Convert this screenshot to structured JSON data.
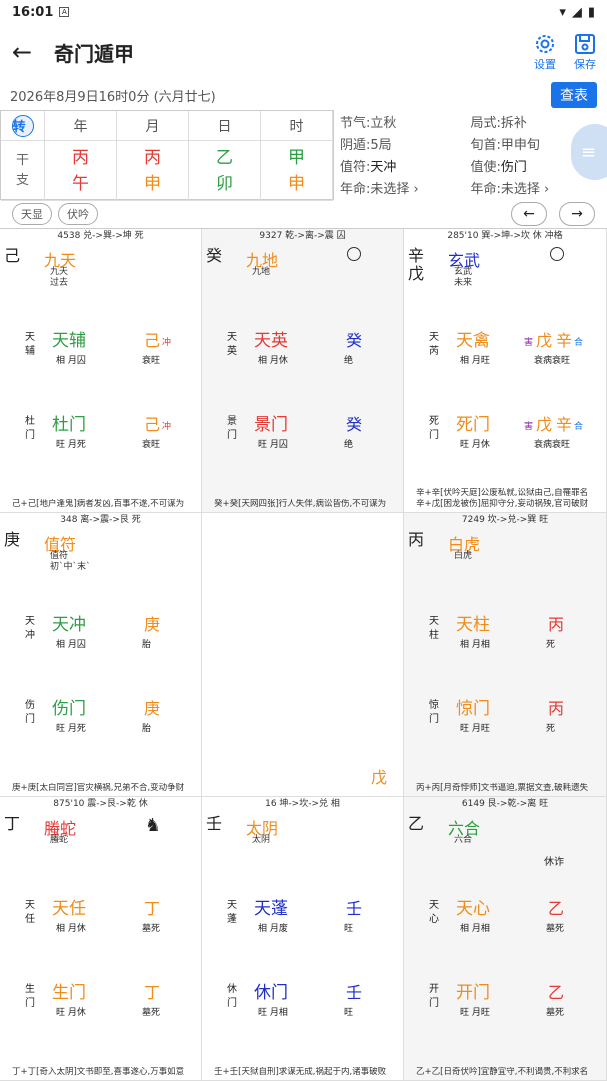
{
  "status": {
    "time": "16:01"
  },
  "app": {
    "title": "奇门遁甲",
    "settings": "设置",
    "save": "保存"
  },
  "date": {
    "text": "2026年8月9日16时0分 (六月廿七)",
    "query": "查表"
  },
  "ganzhi": {
    "zhuan": "转",
    "headers": [
      "年",
      "月",
      "日",
      "时"
    ],
    "label": [
      "干",
      "支"
    ],
    "cols": [
      [
        "丙",
        "午"
      ],
      [
        "丙",
        "申"
      ],
      [
        "乙",
        "卯"
      ],
      [
        "甲",
        "申"
      ]
    ]
  },
  "meta": {
    "jieqi": "节气:立秋",
    "juShi": "局式:拆补",
    "yindun": "阴遁:5局",
    "xunshou": "旬首:甲申旬",
    "zhifu_l": "值符:",
    "zhifu_v": "天冲",
    "zhishi_l": "值使:",
    "zhishi_v": "伤门",
    "nianming1": "年命:未选择 ›",
    "nianming2": "年命:未选择 ›"
  },
  "chips": {
    "a": "天显",
    "b": "伏吟"
  },
  "nav": {
    "prev": "←",
    "next": "→"
  },
  "palaces": [
    {
      "hdr": "4538 兑->巽->坤 死",
      "gan": [
        "己"
      ],
      "god": "九天",
      "godsub": [
        "九天",
        "过去"
      ],
      "star": [
        "天",
        "辅"
      ],
      "starName": "天辅",
      "starSub": "相 月囚",
      "s1": "己",
      "s1sub": "衰旺",
      "s1tag": "冲",
      "door": [
        "杜",
        "门"
      ],
      "doorName": "杜门",
      "doorSub": "旺 月死",
      "s2": "己",
      "s2sub": "衰旺",
      "s2tag": "冲",
      "foot": "己+己[地户逢鬼]病者发凶,百事不遂,不可谋为"
    },
    {
      "hdr": "9327 乾->离->震 囚",
      "gan": [
        "癸"
      ],
      "god": "九地",
      "godsub": [
        "九地"
      ],
      "star": [
        "天",
        "英"
      ],
      "starName": "天英",
      "starSub": "相 月休",
      "s1": "癸",
      "s1sub": "绝",
      "door": [
        "景",
        "门"
      ],
      "doorName": "景门",
      "doorSub": "旺 月囚",
      "s2": "癸",
      "s2sub": "绝",
      "foot": "癸+癸[天网四张]行人失伴,病讼皆伤,不可谋为"
    },
    {
      "hdr": "285'10 巽->坤->坎 休 冲格",
      "gan": [
        "辛",
        "戊"
      ],
      "god": "玄武",
      "godsub": [
        "玄武",
        "未来"
      ],
      "star": [
        "天",
        "芮"
      ],
      "starName": "天禽",
      "starSub": "相 月旺",
      "s1": "戊",
      "s1b": "辛",
      "s1sub": "衰病衰旺",
      "s1tag": "害",
      "s1tag2": "合",
      "door": [
        "死",
        "门"
      ],
      "doorName": "死门",
      "doorSub": "旺 月休",
      "s2": "戊",
      "s2b": "辛",
      "s2sub": "衰病衰旺",
      "s2tag": "害",
      "s2tag2": "合",
      "foot": "辛+辛[伏吟天庭]公废私就,讼狱由己,自罹罪名",
      "foot2": "辛+戊[困龙被伤]屈抑守分,妄动祸殃,官司破财"
    },
    {
      "hdr": "348 离->震->艮 死",
      "gan": [
        "庚"
      ],
      "god": "值符",
      "godsub": [
        "值符",
        "初`中`末`"
      ],
      "star": [
        "天",
        "冲"
      ],
      "starName": "天冲",
      "starSub": "相 月囚",
      "s1": "庚",
      "s1sub": "胎",
      "door": [
        "伤",
        "门"
      ],
      "doorName": "伤门",
      "doorSub": "旺 月死",
      "s2": "庚",
      "s2sub": "胎",
      "foot": "庚+庚[太白同宫]官灾横祸,兄弟不合,变动争财"
    },
    {
      "center": "戊"
    },
    {
      "hdr": "7249 坎->兑->巽 旺",
      "gan": [
        "丙"
      ],
      "god": "白虎",
      "godsub": [
        "白虎"
      ],
      "star": [
        "天",
        "柱"
      ],
      "starName": "天柱",
      "starSub": "相 月相",
      "s1": "丙",
      "s1sub": "死",
      "door": [
        "惊",
        "门"
      ],
      "doorName": "惊门",
      "doorSub": "旺 月旺",
      "s2": "丙",
      "s2sub": "死",
      "foot": "丙+丙[月奇悖师]文书逼迫,票据文查,破耗遗失"
    },
    {
      "hdr": "875'10 震->艮->乾 休",
      "gan": [
        "丁"
      ],
      "god": "螣蛇",
      "godsub": [
        "螣蛇"
      ],
      "star": [
        "天",
        "任"
      ],
      "starName": "天任",
      "starSub": "相 月休",
      "s1": "丁",
      "s1sub": "墓死",
      "door": [
        "生",
        "门"
      ],
      "doorName": "生门",
      "doorSub": "旺 月休",
      "s2": "丁",
      "s2sub": "墓死",
      "foot": "丁+丁[奇入太阴]文书即至,喜事遂心,万事如意",
      "horse": true
    },
    {
      "hdr": "16 坤->坎->兑 相",
      "gan": [
        "壬"
      ],
      "god": "太阴",
      "godsub": [
        "太阴"
      ],
      "star": [
        "天",
        "蓬"
      ],
      "starName": "天蓬",
      "starSub": "相 月废",
      "s1": "壬",
      "s1sub": "旺",
      "door": [
        "休",
        "门"
      ],
      "doorName": "休门",
      "doorSub": "旺 月相",
      "s2": "壬",
      "s2sub": "旺",
      "foot": "壬+壬[天狱自刑]求谋无成,祸起于内,诸事破败"
    },
    {
      "hdr": "6149 艮->乾->离 旺",
      "gan": [
        "乙"
      ],
      "god": "六合",
      "godsub": [
        "六合"
      ],
      "star": [
        "天",
        "心"
      ],
      "starName": "天心",
      "starSub": "相 月相",
      "s1": "乙",
      "s1sub": "墓死",
      "door": [
        "开",
        "门"
      ],
      "doorName": "开门",
      "doorSub": "旺 月旺",
      "s2": "乙",
      "s2sub": "墓死",
      "foot": "乙+乙[日奇伏吟]宜静宜守,不利谒贵,不利求名",
      "xiu": "休诈"
    }
  ],
  "colors": {
    "accent": "#1a73e8",
    "red": "#e53935",
    "green": "#2e9e44",
    "orange": "#ef8c1a",
    "blue": "#1e2fc7"
  }
}
